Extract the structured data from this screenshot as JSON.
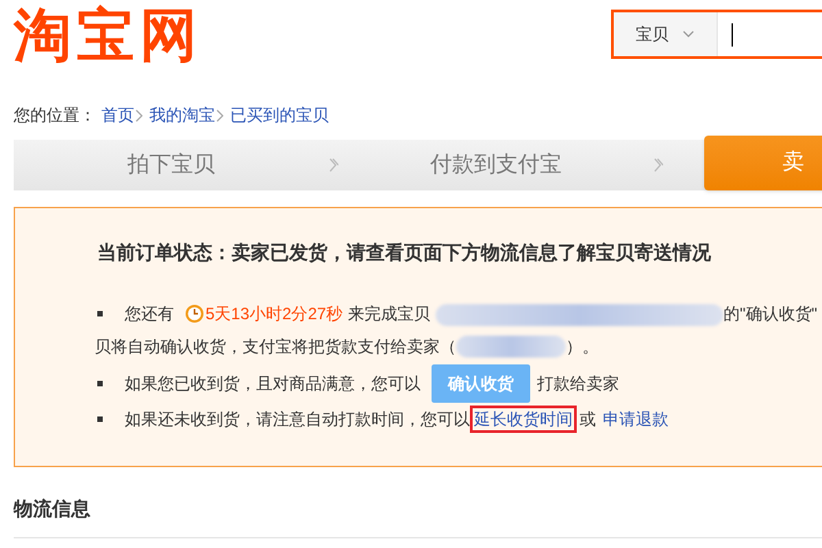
{
  "logo": {
    "text": "淘宝网"
  },
  "search": {
    "scope": "宝贝"
  },
  "breadcrumb": {
    "label": "您的位置：",
    "links": [
      "首页",
      "我的淘宝",
      "已买到的宝贝"
    ]
  },
  "steps": [
    {
      "label": "拍下宝贝",
      "selected": false
    },
    {
      "label": "付款到支付宝",
      "selected": false
    },
    {
      "label": "卖",
      "selected": true
    }
  ],
  "notice": {
    "title": "当前订单状态：卖家已发货，请查看页面下方物流信息了解宝贝寄送情况",
    "line1": {
      "before": "您还有",
      "countdown": "5天13小时2分27秒",
      "middle": "来完成宝贝",
      "after": "的\"确认收货\""
    },
    "line1_cont": {
      "before": "贝将自动确认收货，支付宝将把货款支付给卖家（",
      "after": "）。"
    },
    "line2": {
      "before": "如果您已收到货，且对商品满意，您可以",
      "button": "确认收货",
      "after": "打款给卖家"
    },
    "line3": {
      "before": "如果还未收到货，请注意自动打款时间，您可以",
      "link1": "延长收货时间",
      "link1_highlighted": true,
      "or": "或",
      "link2": "申请退款"
    }
  },
  "logistics": {
    "title": "物流信息"
  }
}
